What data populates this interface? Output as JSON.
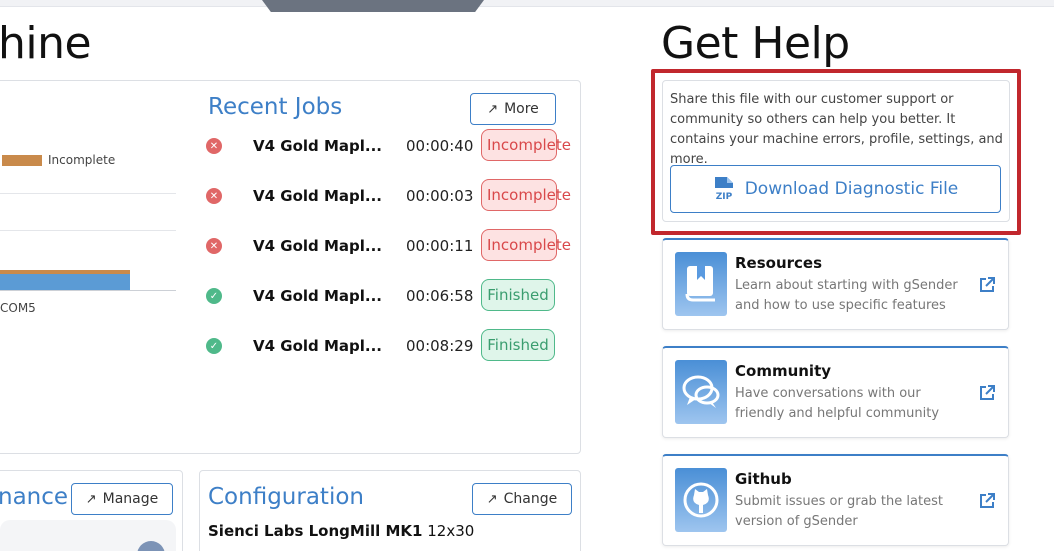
{
  "left_heading": "hine",
  "get_help_heading": "Get Help",
  "chart": {
    "legend_label": "Incomplete",
    "x_tick": "COM5",
    "colors": {
      "incomplete": "#c98a4b",
      "finished": "#5b9bd5"
    }
  },
  "recent_jobs": {
    "title": "Recent Jobs",
    "more_label": "More",
    "jobs": [
      {
        "status": "error",
        "name": "V4 Gold Mapl...",
        "time": "00:00:40",
        "badge": "Incomplete"
      },
      {
        "status": "error",
        "name": "V4 Gold Mapl...",
        "time": "00:00:03",
        "badge": "Incomplete"
      },
      {
        "status": "error",
        "name": "V4 Gold Mapl...",
        "time": "00:00:11",
        "badge": "Incomplete"
      },
      {
        "status": "ok",
        "name": "V4 Gold Mapl...",
        "time": "00:06:58",
        "badge": "Finished"
      },
      {
        "status": "ok",
        "name": "V4 Gold Mapl...",
        "time": "00:08:29",
        "badge": "Finished"
      }
    ]
  },
  "maintenance": {
    "title": "nance",
    "manage_label": "Manage"
  },
  "configuration": {
    "title": "Configuration",
    "change_label": "Change",
    "machine_name": "Sienci Labs LongMill MK1",
    "machine_size": "12x30"
  },
  "help": {
    "description": "Share this file with our customer support or community so others can help you better. It contains your machine errors, profile, settings, and more.",
    "download_label": "Download Diagnostic File",
    "zip_text": "ZIP"
  },
  "resources": [
    {
      "icon": "book-icon",
      "title": "Resources",
      "desc": "Learn about starting with gSender and how to use specific features"
    },
    {
      "icon": "chat-icon",
      "title": "Community",
      "desc": "Have conversations with our friendly and helpful community"
    },
    {
      "icon": "github-icon",
      "title": "Github",
      "desc": "Submit issues or grab the latest version of gSender"
    }
  ],
  "accent_color": "#3d7fc7"
}
